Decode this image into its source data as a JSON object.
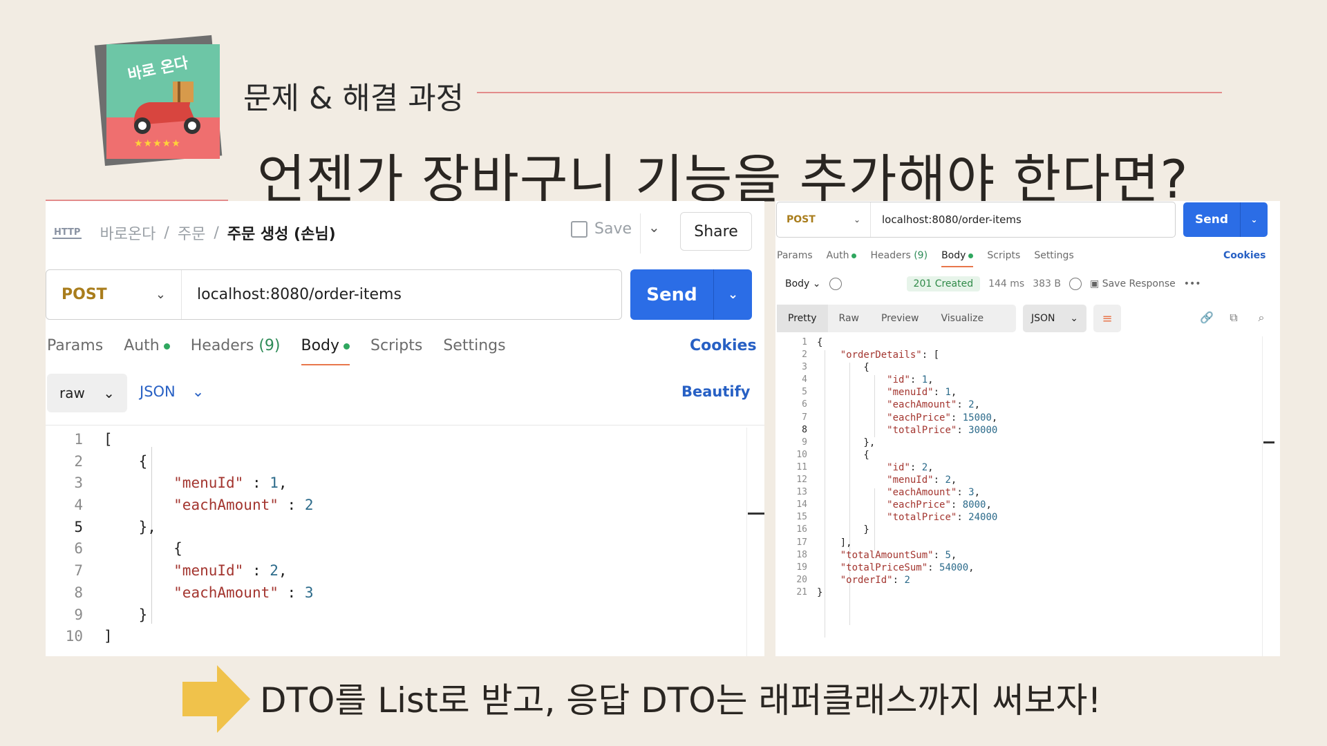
{
  "header": {
    "logo_text": "바로 온다",
    "kicker": "문제 & 해결 과정",
    "headline": "언젠가 장바구니 기능을 추가해야 한다면?"
  },
  "left_panel": {
    "breadcrumb": [
      "바로온다",
      "주문",
      "주문 생성 (손님)"
    ],
    "save_label": "Save",
    "share_label": "Share",
    "method": "POST",
    "url": "localhost:8080/order-items",
    "send_label": "Send",
    "tabs": [
      {
        "label": "Params"
      },
      {
        "label": "Auth",
        "dot": true
      },
      {
        "label": "Headers",
        "count": "(9)"
      },
      {
        "label": "Body",
        "dot": true,
        "active": true
      },
      {
        "label": "Scripts"
      },
      {
        "label": "Settings"
      }
    ],
    "cookies_label": "Cookies",
    "body_type": "raw",
    "body_format": "JSON",
    "beautify_label": "Beautify",
    "code": [
      [
        "1",
        "[",
        ""
      ],
      [
        "2",
        "    {",
        ""
      ],
      [
        "3",
        "        \"menuId\" : 1,",
        ""
      ],
      [
        "4",
        "        \"eachAmount\" : 2",
        ""
      ],
      [
        "5",
        "    },",
        "hl"
      ],
      [
        "6",
        "        {",
        ""
      ],
      [
        "7",
        "        \"menuId\" : 2,",
        ""
      ],
      [
        "8",
        "        \"eachAmount\" : 3",
        ""
      ],
      [
        "9",
        "    }",
        ""
      ],
      [
        "10",
        "]",
        ""
      ]
    ]
  },
  "right_panel": {
    "method": "POST",
    "url": "localhost:8080/order-items",
    "send_label": "Send",
    "tabs": [
      {
        "label": "Params"
      },
      {
        "label": "Auth",
        "dot": true
      },
      {
        "label": "Headers",
        "count": "(9)"
      },
      {
        "label": "Body",
        "dot": true,
        "active": true
      },
      {
        "label": "Scripts"
      },
      {
        "label": "Settings"
      }
    ],
    "cookies_label": "Cookies",
    "response_section": "Body",
    "status": "201 Created",
    "time": "144 ms",
    "size": "383 B",
    "save_response_label": "Save Response",
    "views": [
      "Pretty",
      "Raw",
      "Preview",
      "Visualize"
    ],
    "format": "JSON",
    "code": [
      [
        "1",
        "{",
        ""
      ],
      [
        "2",
        "    \"orderDetails\": [",
        ""
      ],
      [
        "3",
        "        {",
        ""
      ],
      [
        "4",
        "            \"id\": 1,",
        ""
      ],
      [
        "5",
        "            \"menuId\": 1,",
        ""
      ],
      [
        "6",
        "            \"eachAmount\": 2,",
        ""
      ],
      [
        "7",
        "            \"eachPrice\": 15000,",
        ""
      ],
      [
        "8",
        "            \"totalPrice\": 30000",
        "hl"
      ],
      [
        "9",
        "        },",
        ""
      ],
      [
        "10",
        "        {",
        ""
      ],
      [
        "11",
        "            \"id\": 2,",
        ""
      ],
      [
        "12",
        "            \"menuId\": 2,",
        ""
      ],
      [
        "13",
        "            \"eachAmount\": 3,",
        ""
      ],
      [
        "14",
        "            \"eachPrice\": 8000,",
        ""
      ],
      [
        "15",
        "            \"totalPrice\": 24000",
        ""
      ],
      [
        "16",
        "        }",
        ""
      ],
      [
        "17",
        "    ],",
        ""
      ],
      [
        "18",
        "    \"totalAmountSum\": 5,",
        ""
      ],
      [
        "19",
        "    \"totalPriceSum\": 54000,",
        ""
      ],
      [
        "20",
        "    \"orderId\": 2",
        ""
      ],
      [
        "21",
        "}",
        ""
      ]
    ]
  },
  "footer": {
    "text": "DTO를 List로 받고, 응답 DTO는 래퍼클래스까지 써보자!"
  },
  "colors": {
    "background": "#f2ece3",
    "accent_line": "#e38b8b",
    "send_blue": "#2b6de6",
    "method_post": "#a97d1c",
    "arrow_yellow": "#f0c24b"
  }
}
